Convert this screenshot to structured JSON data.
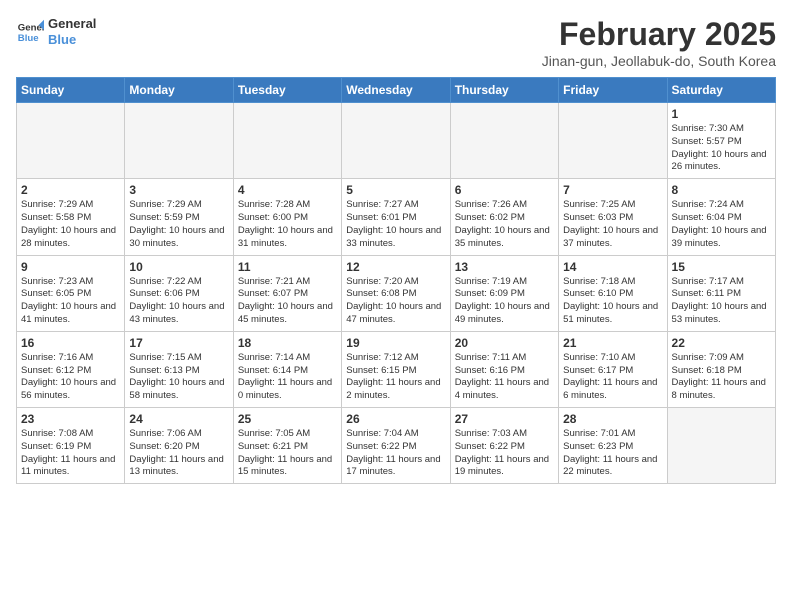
{
  "header": {
    "logo_line1": "General",
    "logo_line2": "Blue",
    "month_title": "February 2025",
    "location": "Jinan-gun, Jeollabuk-do, South Korea"
  },
  "weekdays": [
    "Sunday",
    "Monday",
    "Tuesday",
    "Wednesday",
    "Thursday",
    "Friday",
    "Saturday"
  ],
  "weeks": [
    [
      {
        "day": "",
        "info": ""
      },
      {
        "day": "",
        "info": ""
      },
      {
        "day": "",
        "info": ""
      },
      {
        "day": "",
        "info": ""
      },
      {
        "day": "",
        "info": ""
      },
      {
        "day": "",
        "info": ""
      },
      {
        "day": "1",
        "info": "Sunrise: 7:30 AM\nSunset: 5:57 PM\nDaylight: 10 hours and 26 minutes."
      }
    ],
    [
      {
        "day": "2",
        "info": "Sunrise: 7:29 AM\nSunset: 5:58 PM\nDaylight: 10 hours and 28 minutes."
      },
      {
        "day": "3",
        "info": "Sunrise: 7:29 AM\nSunset: 5:59 PM\nDaylight: 10 hours and 30 minutes."
      },
      {
        "day": "4",
        "info": "Sunrise: 7:28 AM\nSunset: 6:00 PM\nDaylight: 10 hours and 31 minutes."
      },
      {
        "day": "5",
        "info": "Sunrise: 7:27 AM\nSunset: 6:01 PM\nDaylight: 10 hours and 33 minutes."
      },
      {
        "day": "6",
        "info": "Sunrise: 7:26 AM\nSunset: 6:02 PM\nDaylight: 10 hours and 35 minutes."
      },
      {
        "day": "7",
        "info": "Sunrise: 7:25 AM\nSunset: 6:03 PM\nDaylight: 10 hours and 37 minutes."
      },
      {
        "day": "8",
        "info": "Sunrise: 7:24 AM\nSunset: 6:04 PM\nDaylight: 10 hours and 39 minutes."
      }
    ],
    [
      {
        "day": "9",
        "info": "Sunrise: 7:23 AM\nSunset: 6:05 PM\nDaylight: 10 hours and 41 minutes."
      },
      {
        "day": "10",
        "info": "Sunrise: 7:22 AM\nSunset: 6:06 PM\nDaylight: 10 hours and 43 minutes."
      },
      {
        "day": "11",
        "info": "Sunrise: 7:21 AM\nSunset: 6:07 PM\nDaylight: 10 hours and 45 minutes."
      },
      {
        "day": "12",
        "info": "Sunrise: 7:20 AM\nSunset: 6:08 PM\nDaylight: 10 hours and 47 minutes."
      },
      {
        "day": "13",
        "info": "Sunrise: 7:19 AM\nSunset: 6:09 PM\nDaylight: 10 hours and 49 minutes."
      },
      {
        "day": "14",
        "info": "Sunrise: 7:18 AM\nSunset: 6:10 PM\nDaylight: 10 hours and 51 minutes."
      },
      {
        "day": "15",
        "info": "Sunrise: 7:17 AM\nSunset: 6:11 PM\nDaylight: 10 hours and 53 minutes."
      }
    ],
    [
      {
        "day": "16",
        "info": "Sunrise: 7:16 AM\nSunset: 6:12 PM\nDaylight: 10 hours and 56 minutes."
      },
      {
        "day": "17",
        "info": "Sunrise: 7:15 AM\nSunset: 6:13 PM\nDaylight: 10 hours and 58 minutes."
      },
      {
        "day": "18",
        "info": "Sunrise: 7:14 AM\nSunset: 6:14 PM\nDaylight: 11 hours and 0 minutes."
      },
      {
        "day": "19",
        "info": "Sunrise: 7:12 AM\nSunset: 6:15 PM\nDaylight: 11 hours and 2 minutes."
      },
      {
        "day": "20",
        "info": "Sunrise: 7:11 AM\nSunset: 6:16 PM\nDaylight: 11 hours and 4 minutes."
      },
      {
        "day": "21",
        "info": "Sunrise: 7:10 AM\nSunset: 6:17 PM\nDaylight: 11 hours and 6 minutes."
      },
      {
        "day": "22",
        "info": "Sunrise: 7:09 AM\nSunset: 6:18 PM\nDaylight: 11 hours and 8 minutes."
      }
    ],
    [
      {
        "day": "23",
        "info": "Sunrise: 7:08 AM\nSunset: 6:19 PM\nDaylight: 11 hours and 11 minutes."
      },
      {
        "day": "24",
        "info": "Sunrise: 7:06 AM\nSunset: 6:20 PM\nDaylight: 11 hours and 13 minutes."
      },
      {
        "day": "25",
        "info": "Sunrise: 7:05 AM\nSunset: 6:21 PM\nDaylight: 11 hours and 15 minutes."
      },
      {
        "day": "26",
        "info": "Sunrise: 7:04 AM\nSunset: 6:22 PM\nDaylight: 11 hours and 17 minutes."
      },
      {
        "day": "27",
        "info": "Sunrise: 7:03 AM\nSunset: 6:22 PM\nDaylight: 11 hours and 19 minutes."
      },
      {
        "day": "28",
        "info": "Sunrise: 7:01 AM\nSunset: 6:23 PM\nDaylight: 11 hours and 22 minutes."
      },
      {
        "day": "",
        "info": ""
      }
    ]
  ]
}
